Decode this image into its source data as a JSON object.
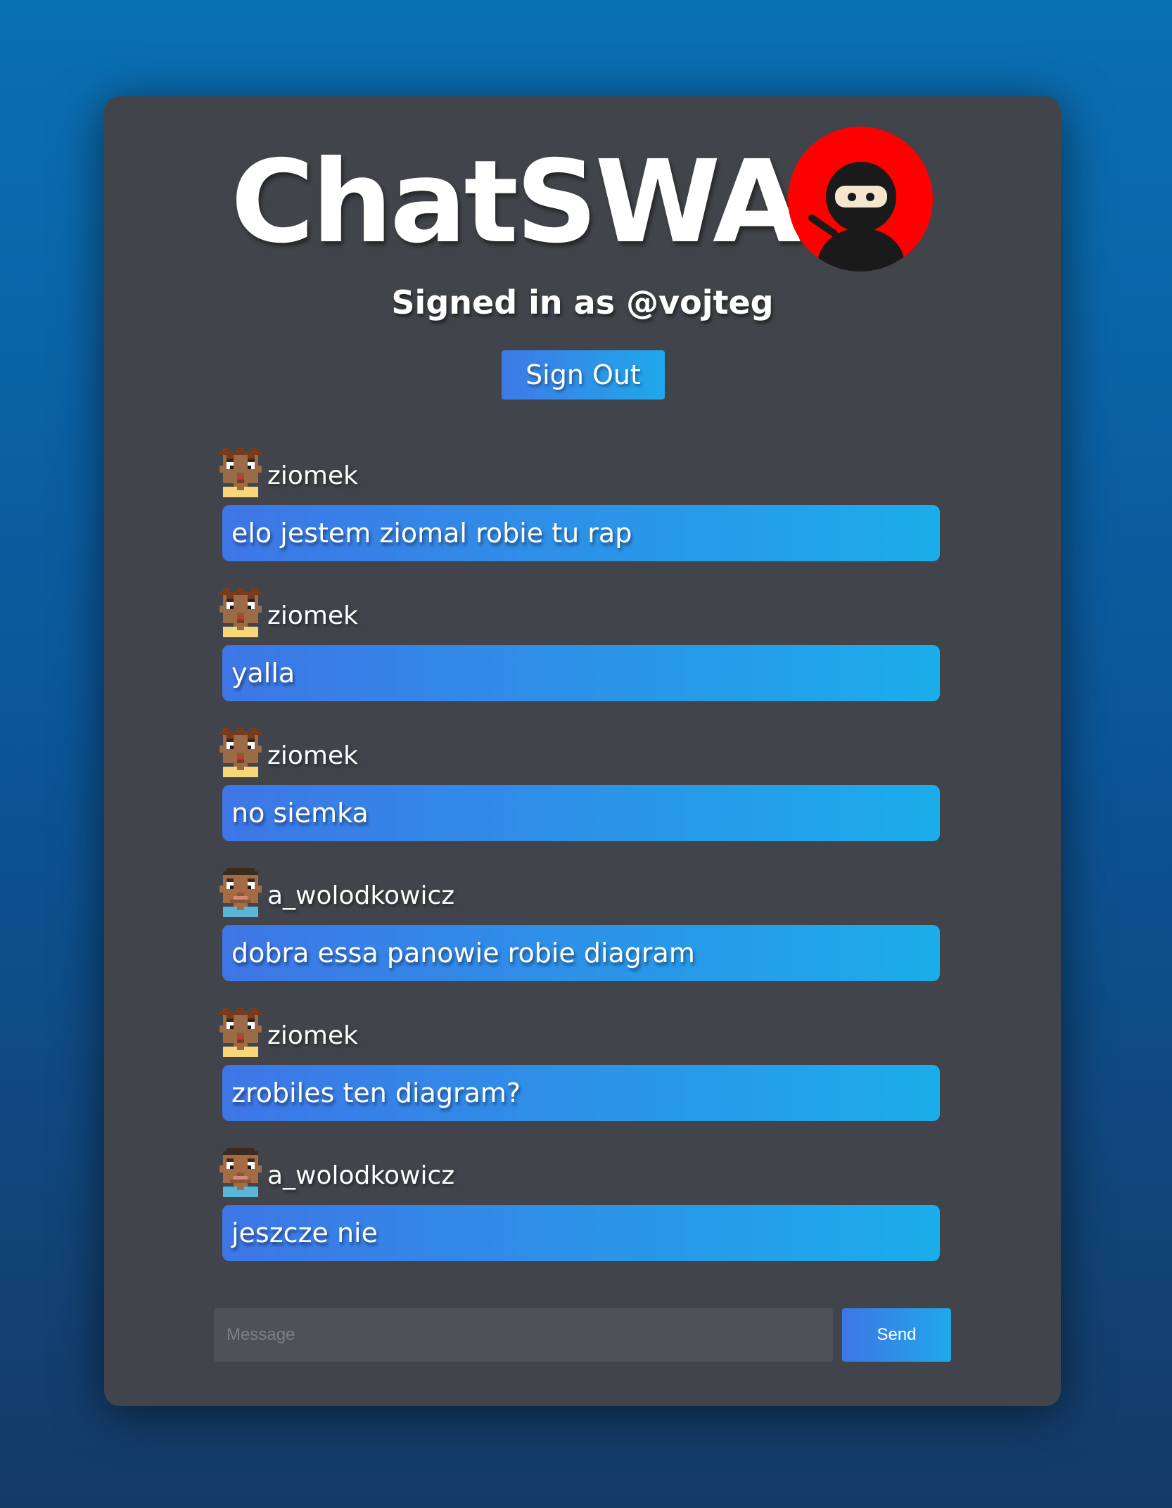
{
  "app": {
    "title": "ChatSWA",
    "logo_icon": "ninja-icon",
    "logo_color": "#ff0000"
  },
  "session": {
    "signed_in_text": "Signed in as @vojteg",
    "sign_out_label": "Sign Out"
  },
  "messages": [
    {
      "user": "ziomek",
      "avatar": "pixel-avatar-ziomek",
      "text": "elo jestem ziomal robie tu rap"
    },
    {
      "user": "ziomek",
      "avatar": "pixel-avatar-ziomek",
      "text": "yalla"
    },
    {
      "user": "ziomek",
      "avatar": "pixel-avatar-ziomek",
      "text": "no siemka"
    },
    {
      "user": "a_wolodkowicz",
      "avatar": "pixel-avatar-a-wolodkowicz",
      "text": "dobra essa panowie robie diagram"
    },
    {
      "user": "ziomek",
      "avatar": "pixel-avatar-ziomek",
      "text": "zrobiles ten diagram?"
    },
    {
      "user": "a_wolodkowicz",
      "avatar": "pixel-avatar-a-wolodkowicz",
      "text": "jeszcze nie"
    }
  ],
  "composer": {
    "placeholder": "Message",
    "value": "",
    "send_label": "Send"
  },
  "colors": {
    "page_background": "#0b5597",
    "card_background": "#41444a",
    "accent_start": "#3e76e6",
    "accent_end": "#1badea"
  }
}
